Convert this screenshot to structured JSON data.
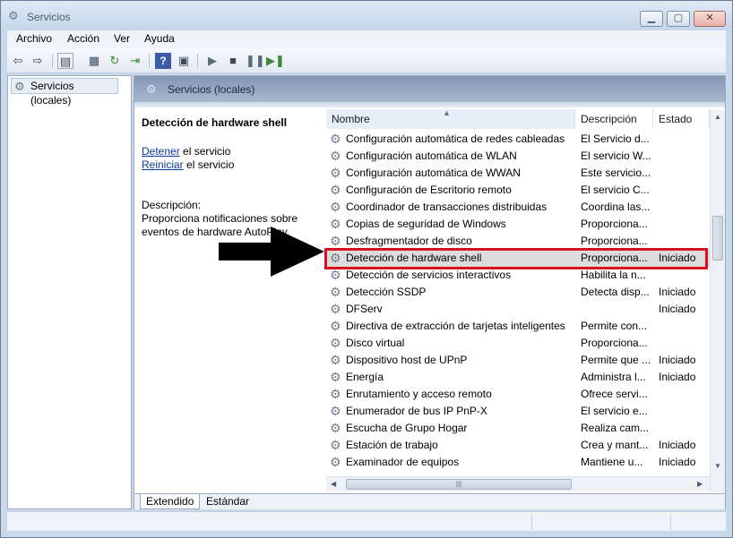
{
  "window": {
    "title": "Servicios"
  },
  "menu": [
    "Archivo",
    "Acción",
    "Ver",
    "Ayuda"
  ],
  "tree": {
    "root_label": "Servicios (locales)"
  },
  "panel": {
    "header": "Servicios (locales)",
    "service_title": "Detección de hardware shell",
    "stop_link": "Detener",
    "stop_suffix": " el servicio",
    "restart_link": "Reiniciar",
    "restart_suffix": " el servicio",
    "description_label": "Descripción:",
    "description_line1": "Proporciona notificaciones sobre",
    "description_line2": "eventos de hardware AutoPlay."
  },
  "list": {
    "columns": [
      "Nombre",
      "Descripción",
      "Estado"
    ],
    "rows": [
      {
        "name": "Configuración automática de redes cableadas",
        "desc": "El Servicio d...",
        "state": ""
      },
      {
        "name": "Configuración automática de WLAN",
        "desc": "El servicio W...",
        "state": ""
      },
      {
        "name": "Configuración automática de WWAN",
        "desc": "Este servicio...",
        "state": ""
      },
      {
        "name": "Configuración de Escritorio remoto",
        "desc": "El servicio C...",
        "state": ""
      },
      {
        "name": "Coordinador de transacciones distribuidas",
        "desc": "Coordina las...",
        "state": ""
      },
      {
        "name": "Copias de seguridad de Windows",
        "desc": "Proporciona...",
        "state": ""
      },
      {
        "name": "Desfragmentador de disco",
        "desc": "Proporciona...",
        "state": ""
      },
      {
        "name": "Detección de hardware shell",
        "desc": "Proporciona...",
        "state": "Iniciado"
      },
      {
        "name": "Detección de servicios interactivos",
        "desc": "Habilita la n...",
        "state": ""
      },
      {
        "name": "Detección SSDP",
        "desc": "Detecta disp...",
        "state": "Iniciado"
      },
      {
        "name": "DFServ",
        "desc": "",
        "state": "Iniciado"
      },
      {
        "name": "Directiva de extracción de tarjetas inteligentes",
        "desc": "Permite con...",
        "state": ""
      },
      {
        "name": "Disco virtual",
        "desc": "Proporciona...",
        "state": ""
      },
      {
        "name": "Dispositivo host de UPnP",
        "desc": "Permite que ...",
        "state": "Iniciado"
      },
      {
        "name": "Energía",
        "desc": "Administra l...",
        "state": "Iniciado"
      },
      {
        "name": "Enrutamiento y acceso remoto",
        "desc": "Ofrece servi...",
        "state": ""
      },
      {
        "name": "Enumerador de bus IP PnP-X",
        "desc": "El servicio e...",
        "state": ""
      },
      {
        "name": "Escucha de Grupo Hogar",
        "desc": "Realiza cam...",
        "state": ""
      },
      {
        "name": "Estación de trabajo",
        "desc": "Crea y mant...",
        "state": "Iniciado"
      },
      {
        "name": "Examinador de equipos",
        "desc": "Mantiene u...",
        "state": "Iniciado"
      }
    ],
    "selected_index": 7
  },
  "tabs": [
    "Extendido",
    "Estándar"
  ],
  "colors": {
    "highlight": "#d81020",
    "link": "#0b3c9c"
  }
}
